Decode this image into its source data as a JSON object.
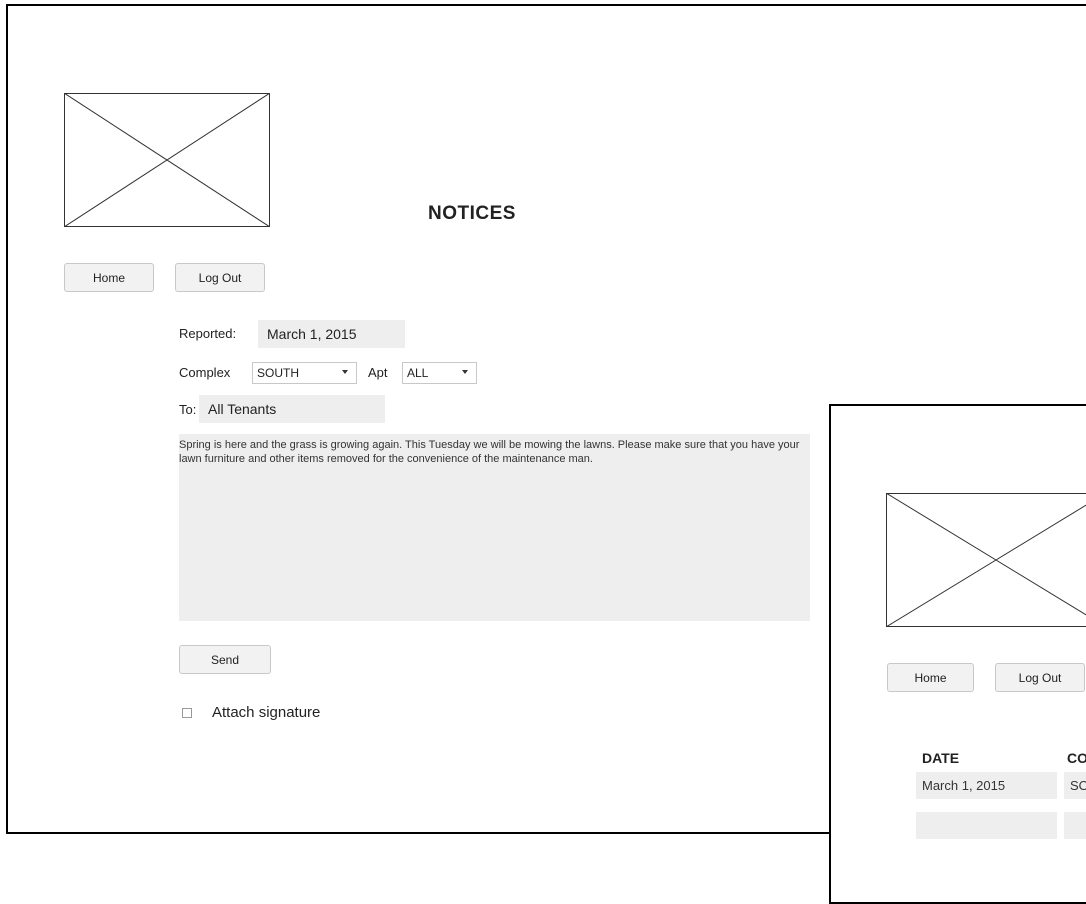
{
  "page": {
    "title": "NOTICES",
    "nav": {
      "home_label": "Home",
      "logout_label": "Log Out"
    }
  },
  "form": {
    "reported_label": "Reported:",
    "reported_value": "March 1, 2015",
    "complex_label": "Complex",
    "complex_value": "SOUTH",
    "apt_label": "Apt",
    "apt_value": "ALL",
    "to_label": "To:",
    "to_value": "All Tenants",
    "message": "Spring is here and the grass is growing again.  This Tuesday we will be mowing the lawns. Please make sure that you have your lawn furniture and other items removed for the convenience of the maintenance man.",
    "send_label": "Send",
    "attach_label": "Attach signature"
  },
  "second_panel": {
    "nav": {
      "home_label": "Home",
      "logout_label": "Log Out"
    },
    "table": {
      "headers": [
        "DATE",
        "CO"
      ],
      "rows": [
        [
          "March 1, 2015",
          "SO"
        ]
      ]
    }
  }
}
